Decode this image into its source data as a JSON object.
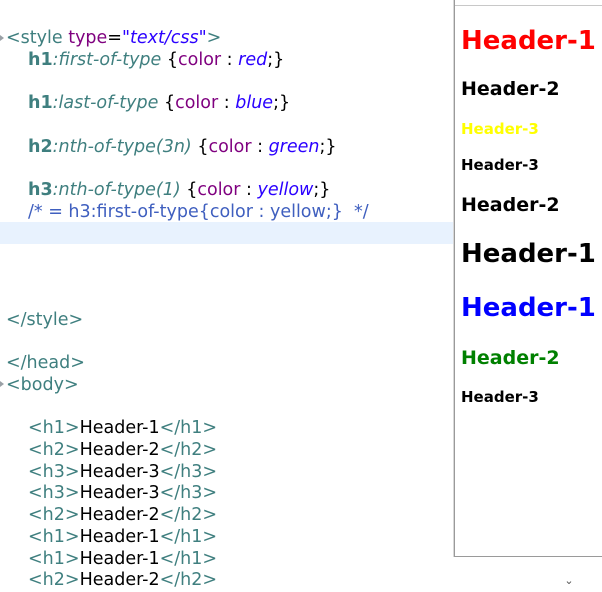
{
  "editor": {
    "lines": [
      {
        "tokens": [
          {
            "cls": "tag",
            "text": "<style "
          },
          {
            "cls": "attr",
            "text": "type"
          },
          {
            "cls": "txt",
            "text": "="
          },
          {
            "cls": "str",
            "text": "\"text/css\""
          },
          {
            "cls": "tag",
            "text": ">"
          }
        ]
      },
      {
        "indent": true,
        "tokens": [
          {
            "cls": "sel",
            "text": "h1"
          },
          {
            "cls": "pcls",
            "text": ":first-of-type "
          },
          {
            "cls": "brace",
            "text": "{"
          },
          {
            "cls": "prop",
            "text": "color"
          },
          {
            "cls": "brace",
            "text": " : "
          },
          {
            "cls": "pval",
            "text": "red"
          },
          {
            "cls": "brace",
            "text": ";}"
          }
        ]
      },
      {
        "indent": true,
        "tokens": [
          {
            "cls": "sel",
            "text": "h1"
          },
          {
            "cls": "pcls",
            "text": ":last-of-type "
          },
          {
            "cls": "brace",
            "text": "{"
          },
          {
            "cls": "prop",
            "text": "color"
          },
          {
            "cls": "brace",
            "text": " : "
          },
          {
            "cls": "pval",
            "text": "blue"
          },
          {
            "cls": "brace",
            "text": ";}"
          }
        ]
      },
      {
        "indent": true,
        "tokens": [
          {
            "cls": "sel",
            "text": "h2"
          },
          {
            "cls": "pcls",
            "text": ":nth-of-type(3n) "
          },
          {
            "cls": "brace",
            "text": "{"
          },
          {
            "cls": "prop",
            "text": "color"
          },
          {
            "cls": "brace",
            "text": " : "
          },
          {
            "cls": "pval",
            "text": "green"
          },
          {
            "cls": "brace",
            "text": ";}"
          }
        ]
      },
      {
        "indent": true,
        "tokens": [
          {
            "cls": "sel",
            "text": "h3"
          },
          {
            "cls": "pcls",
            "text": ":nth-of-type(1) "
          },
          {
            "cls": "brace",
            "text": "{"
          },
          {
            "cls": "prop",
            "text": "color"
          },
          {
            "cls": "brace",
            "text": " : "
          },
          {
            "cls": "pval",
            "text": "yellow"
          },
          {
            "cls": "brace",
            "text": ";}"
          }
        ]
      },
      {
        "indent": true,
        "tokens": [
          {
            "cls": "cmt",
            "text": "/* = h3:first-of-type{color : yellow;}  */"
          }
        ]
      },
      {
        "tokens": [
          {
            "cls": "tag",
            "text": "</style>"
          }
        ]
      },
      {
        "tokens": [
          {
            "cls": "tag",
            "text": "</head>"
          }
        ]
      },
      {
        "tokens": [
          {
            "cls": "tag",
            "text": "<body>"
          }
        ]
      },
      {
        "indent": true,
        "tokens": [
          {
            "cls": "tag",
            "text": "<h1>"
          },
          {
            "cls": "txt",
            "text": "Header-1"
          },
          {
            "cls": "tag",
            "text": "</h1>"
          }
        ]
      },
      {
        "indent": true,
        "tokens": [
          {
            "cls": "tag",
            "text": "<h2>"
          },
          {
            "cls": "txt",
            "text": "Header-2"
          },
          {
            "cls": "tag",
            "text": "</h2>"
          }
        ]
      },
      {
        "indent": true,
        "tokens": [
          {
            "cls": "tag",
            "text": "<h3>"
          },
          {
            "cls": "txt",
            "text": "Header-3"
          },
          {
            "cls": "tag",
            "text": "</h3>"
          }
        ]
      },
      {
        "indent": true,
        "tokens": [
          {
            "cls": "tag",
            "text": "<h3>"
          },
          {
            "cls": "txt",
            "text": "Header-3"
          },
          {
            "cls": "tag",
            "text": "</h3>"
          }
        ]
      },
      {
        "indent": true,
        "tokens": [
          {
            "cls": "tag",
            "text": "<h2>"
          },
          {
            "cls": "txt",
            "text": "Header-2"
          },
          {
            "cls": "tag",
            "text": "</h2>"
          }
        ]
      },
      {
        "indent": true,
        "tokens": [
          {
            "cls": "tag",
            "text": "<h1>"
          },
          {
            "cls": "txt",
            "text": "Header-1"
          },
          {
            "cls": "tag",
            "text": "</h1>"
          }
        ]
      },
      {
        "indent": true,
        "tokens": [
          {
            "cls": "tag",
            "text": "<h1>"
          },
          {
            "cls": "txt",
            "text": "Header-1"
          },
          {
            "cls": "tag",
            "text": "</h1>"
          }
        ]
      },
      {
        "indent": true,
        "tokens": [
          {
            "cls": "tag",
            "text": "<h2>"
          },
          {
            "cls": "txt",
            "text": "Header-2"
          },
          {
            "cls": "tag",
            "text": "</h2>"
          }
        ]
      }
    ]
  },
  "preview": {
    "headings": [
      {
        "level": "h1",
        "text": "Header-1",
        "color": "#ff0000"
      },
      {
        "level": "h2",
        "text": "Header-2",
        "color": "#000000"
      },
      {
        "level": "h3",
        "text": "Header-3",
        "color": "#ffff00"
      },
      {
        "level": "h3",
        "text": "Header-3",
        "color": "#000000"
      },
      {
        "level": "h2",
        "text": "Header-2",
        "color": "#000000"
      },
      {
        "level": "h1",
        "text": "Header-1",
        "color": "#000000"
      },
      {
        "level": "h1",
        "text": "Header-1",
        "color": "#0000ff"
      },
      {
        "level": "h2",
        "text": "Header-2",
        "color": "#008000"
      },
      {
        "level": "h3",
        "text": "Header-3",
        "color": "#000000"
      }
    ]
  },
  "scrollbar": {
    "down_arrow": "⌄"
  }
}
